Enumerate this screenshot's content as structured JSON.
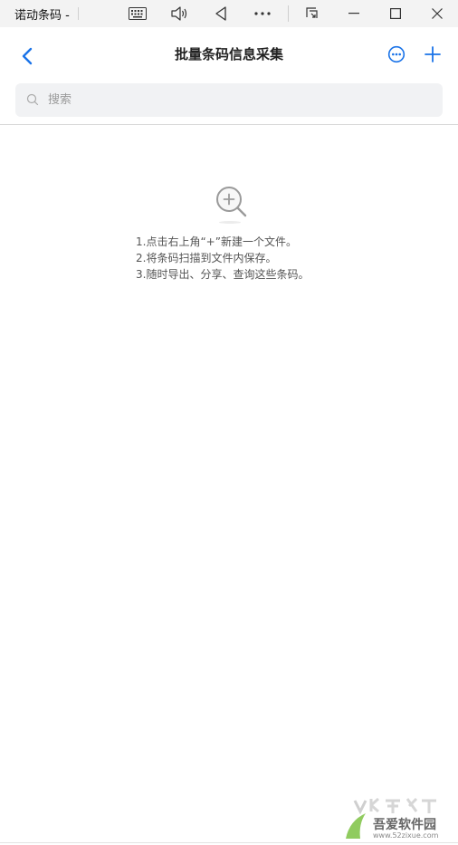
{
  "window": {
    "title": "诺动条码 - "
  },
  "titlebar": {
    "icons": [
      "keyboard-icon",
      "volume-icon",
      "back-triangle-icon",
      "more-dots-icon",
      "screenshot-icon",
      "minimize-icon",
      "maximize-icon",
      "close-icon"
    ]
  },
  "header": {
    "title": "批量条码信息采集",
    "back_icon": "chevron-left-icon",
    "more_icon": "more-circle-icon",
    "add_icon": "plus-icon"
  },
  "search": {
    "placeholder": "搜索",
    "value": ""
  },
  "empty_state": {
    "icon": "zoom-in-icon",
    "tips": [
      "1.点击右上角“+”新建一个文件。",
      "2.将条码扫描到文件内保存。",
      "3.随时导出、分享、查询这些条码。"
    ]
  },
  "watermark": {
    "text": "吾爱软件园",
    "url": "www.52zixue.com"
  },
  "colors": {
    "accent": "#1a73e8",
    "titlebar_bg": "#f3f3f3",
    "search_bg": "#f1f2f4",
    "text_primary": "#222222",
    "text_secondary": "#555555"
  }
}
